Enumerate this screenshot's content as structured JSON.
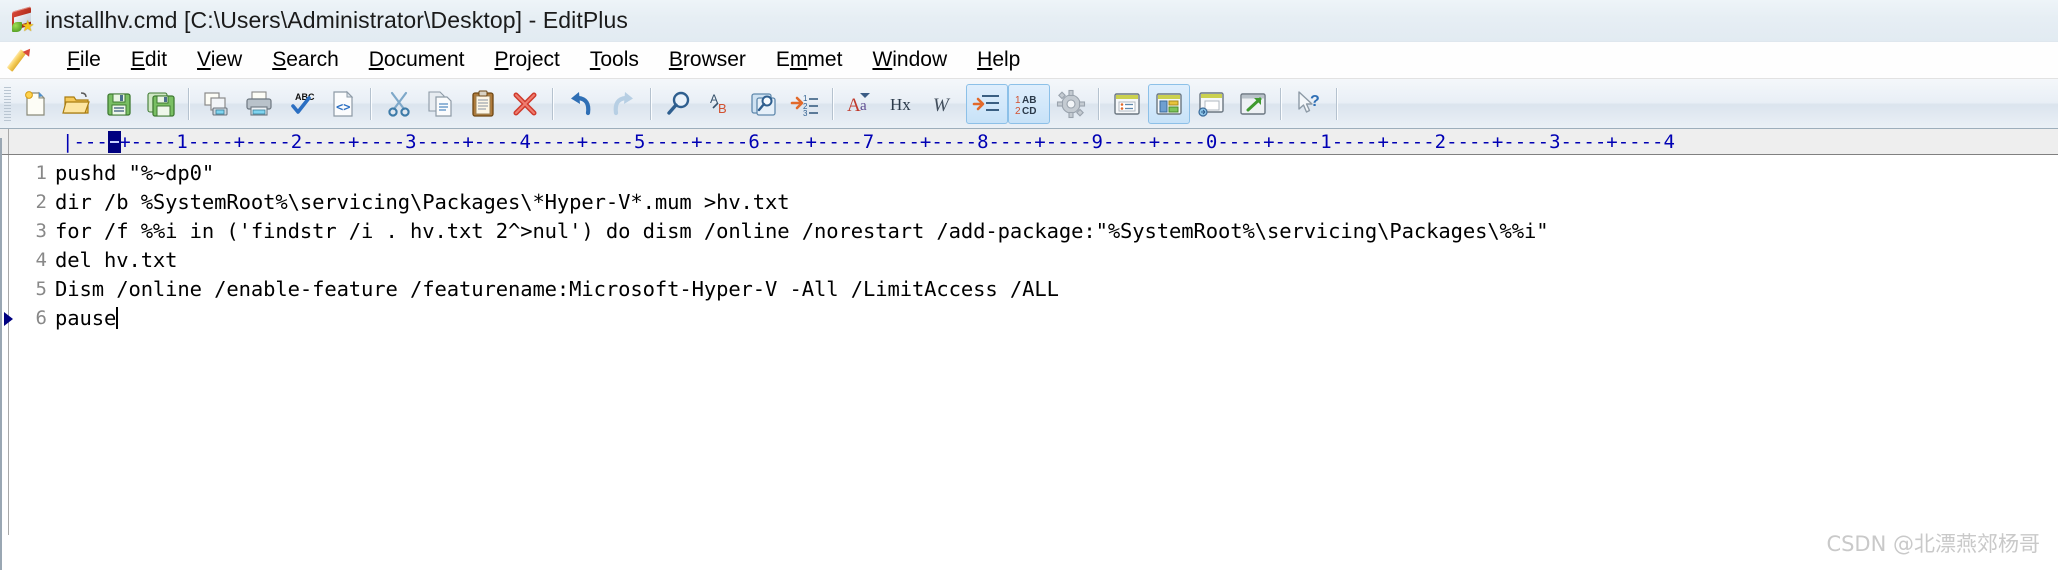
{
  "window": {
    "title": "installhv.cmd [C:\\Users\\Administrator\\Desktop] - EditPlus",
    "app_icon": "editplus-document-icon"
  },
  "menubar": {
    "icon": "pencil-icon",
    "items": [
      {
        "label": "File",
        "accel": "F"
      },
      {
        "label": "Edit",
        "accel": "E"
      },
      {
        "label": "View",
        "accel": "V"
      },
      {
        "label": "Search",
        "accel": "S"
      },
      {
        "label": "Document",
        "accel": "D"
      },
      {
        "label": "Project",
        "accel": "P"
      },
      {
        "label": "Tools",
        "accel": "T"
      },
      {
        "label": "Browser",
        "accel": "B"
      },
      {
        "label": "Emmet",
        "accel": "m"
      },
      {
        "label": "Window",
        "accel": "W"
      },
      {
        "label": "Help",
        "accel": "H"
      }
    ]
  },
  "toolbar": {
    "groups": [
      {
        "buttons": [
          {
            "icon": "new-document-icon",
            "name": "new-file-button",
            "active": false
          },
          {
            "icon": "open-folder-icon",
            "name": "open-file-button",
            "active": false
          },
          {
            "icon": "save-icon",
            "name": "save-button",
            "active": false
          },
          {
            "icon": "save-all-icon",
            "name": "save-all-button",
            "active": false
          }
        ]
      },
      {
        "buttons": [
          {
            "icon": "print-preview-icon",
            "name": "print-preview-button",
            "active": false
          },
          {
            "icon": "printer-icon",
            "name": "print-button",
            "active": false
          },
          {
            "icon": "spellcheck-icon",
            "name": "spell-check-button",
            "active": false
          },
          {
            "icon": "code-page-icon",
            "name": "view-in-browser-button",
            "active": false
          }
        ]
      },
      {
        "buttons": [
          {
            "icon": "scissors-icon",
            "name": "cut-button",
            "active": false
          },
          {
            "icon": "copy-icon",
            "name": "copy-button",
            "active": false
          },
          {
            "icon": "clipboard-icon",
            "name": "paste-button",
            "active": false
          },
          {
            "icon": "red-x-icon",
            "name": "delete-button",
            "active": false
          }
        ]
      },
      {
        "buttons": [
          {
            "icon": "undo-arrow-icon",
            "name": "undo-button",
            "active": false
          },
          {
            "icon": "redo-arrow-icon",
            "name": "redo-button",
            "active": false
          }
        ]
      },
      {
        "buttons": [
          {
            "icon": "magnifier-icon",
            "name": "find-button",
            "active": false
          },
          {
            "icon": "find-replace-ab-icon",
            "name": "replace-button",
            "active": false
          },
          {
            "icon": "find-in-files-icon",
            "name": "find-in-files-button",
            "active": false
          },
          {
            "icon": "goto-line-icon",
            "name": "goto-line-button",
            "active": false
          }
        ]
      },
      {
        "buttons": [
          {
            "icon": "font-format-icon",
            "name": "change-case-button",
            "active": false
          },
          {
            "icon": "hex-icon",
            "name": "hex-viewer-button",
            "active": false
          },
          {
            "icon": "word-wrap-w-icon",
            "name": "word-wrap-button",
            "active": false
          },
          {
            "icon": "indent-icon",
            "name": "auto-indent-button",
            "active": true
          },
          {
            "icon": "line-numbers-icon",
            "name": "line-numbers-button",
            "active": true
          },
          {
            "icon": "gear-icon",
            "name": "preferences-button",
            "active": false
          }
        ]
      },
      {
        "buttons": [
          {
            "icon": "document-list-icon",
            "name": "document-selector-button",
            "active": false
          },
          {
            "icon": "layout-panel-icon",
            "name": "toggle-panel-button",
            "active": true
          },
          {
            "icon": "ftp-window-icon",
            "name": "ftp-upload-button",
            "active": false
          },
          {
            "icon": "external-window-icon",
            "name": "new-window-button",
            "active": false
          }
        ]
      },
      {
        "buttons": [
          {
            "icon": "help-cursor-icon",
            "name": "context-help-button",
            "active": false
          }
        ]
      }
    ]
  },
  "ruler": {
    "marks": "|----+----1----+----2----+----3----+----4----+----5----+----6----+----7----+----8----+----9----+----0----+----1----+----2----+----3----+----4",
    "caret_column": 1
  },
  "editor": {
    "lines": [
      {
        "number": "1",
        "text": "pushd \"%~dp0\"",
        "current": false
      },
      {
        "number": "2",
        "text": "dir /b %SystemRoot%\\servicing\\Packages\\*Hyper-V*.mum >hv.txt",
        "current": false
      },
      {
        "number": "3",
        "text": "for /f %%i in ('findstr /i . hv.txt 2^>nul') do dism /online /norestart /add-package:\"%SystemRoot%\\servicing\\Packages\\%%i\"",
        "current": false
      },
      {
        "number": "4",
        "text": "del hv.txt",
        "current": false
      },
      {
        "number": "5",
        "text": "Dism /online /enable-feature /featurename:Microsoft-Hyper-V -All /LimitAccess /ALL",
        "current": false
      },
      {
        "number": "6",
        "text": "pause",
        "current": true
      }
    ]
  },
  "watermark": {
    "text": "CSDN @北漂燕郊杨哥"
  },
  "colors": {
    "title_bar": "#e6eef4",
    "toolbar_bg": "#e9eff6",
    "ruler_text": "#0000b4",
    "gutter_text": "#888888",
    "code_text": "#000000",
    "caret_marker": "#000080",
    "watermark": "#c9c9c9"
  }
}
